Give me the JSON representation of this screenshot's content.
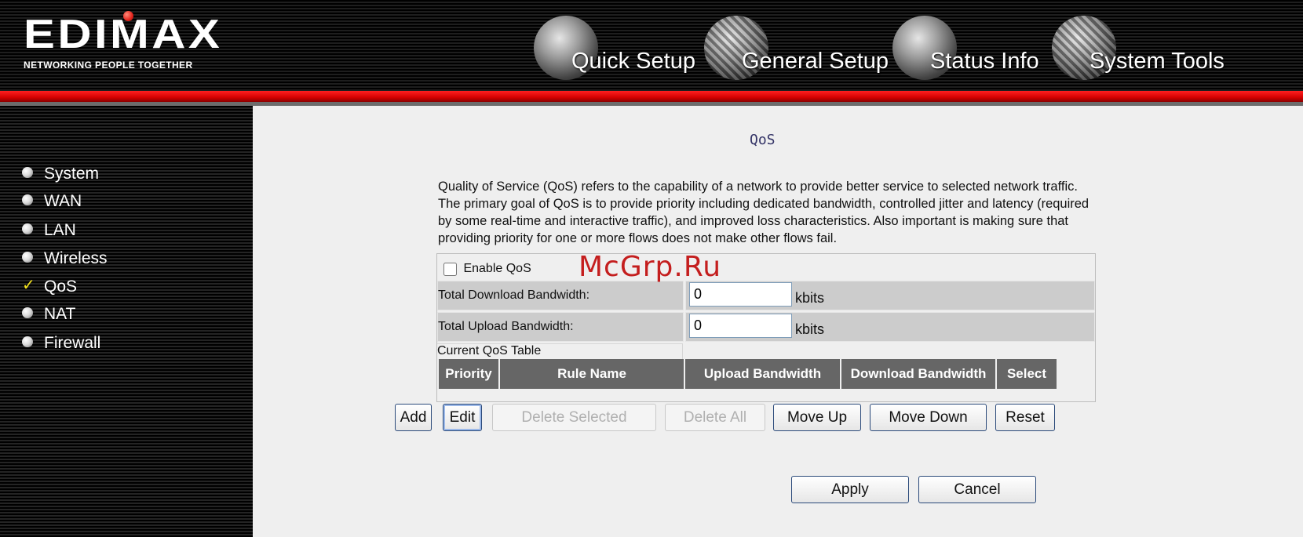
{
  "brand": {
    "logo": "EDIMAX",
    "tagline": "NETWORKING PEOPLE TOGETHER"
  },
  "top_nav": [
    {
      "label": "Quick Setup",
      "icon": "quick-setup-icon"
    },
    {
      "label": "General Setup",
      "icon": "general-setup-icon"
    },
    {
      "label": "Status Info",
      "icon": "status-info-icon"
    },
    {
      "label": "System Tools",
      "icon": "system-tools-icon"
    }
  ],
  "sidebar": {
    "items": [
      {
        "label": "System",
        "marker": "bullet"
      },
      {
        "label": "WAN",
        "marker": "bullet"
      },
      {
        "label": "LAN",
        "marker": "bullet"
      },
      {
        "label": "Wireless",
        "marker": "bullet"
      },
      {
        "label": "QoS",
        "marker": "check",
        "active": true
      },
      {
        "label": "NAT",
        "marker": "bullet"
      },
      {
        "label": "Firewall",
        "marker": "bullet"
      }
    ],
    "check_glyph": "✓"
  },
  "main": {
    "title": "QoS",
    "description": "Quality of Service (QoS) refers to the capability of a network to provide better service to selected network traffic. The primary goal of QoS is to provide priority including dedicated bandwidth, controlled jitter and latency (required by some real-time and interactive traffic), and improved loss characteristics. Also important is making sure that providing priority for one or more flows does not make other flows fail.",
    "enable_qos": {
      "label": "Enable QoS",
      "checked": false
    },
    "download": {
      "label": "Total Download Bandwidth:",
      "value": "0",
      "unit": "kbits"
    },
    "upload": {
      "label": "Total Upload Bandwidth:",
      "value": "0",
      "unit": "kbits"
    },
    "table_title": "Current QoS Table",
    "columns": [
      "Priority",
      "Rule Name",
      "Upload Bandwidth",
      "Download Bandwidth",
      "Select"
    ],
    "rows": []
  },
  "buttons": {
    "add": "Add",
    "edit": "Edit",
    "delete_selected": "Delete Selected",
    "delete_all": "Delete All",
    "move_up": "Move Up",
    "move_down": "Move Down",
    "reset": "Reset",
    "apply": "Apply",
    "cancel": "Cancel"
  },
  "watermark": "McGrp.Ru",
  "colors": {
    "header_bg": "#000000",
    "red_bar": "#d40000",
    "content_bg": "#efefef",
    "table_header_bg": "#666666",
    "row_bg": "#cccccc",
    "title_color": "#333366",
    "watermark_color": "#c41e1e",
    "check_color": "#f2e21d"
  }
}
